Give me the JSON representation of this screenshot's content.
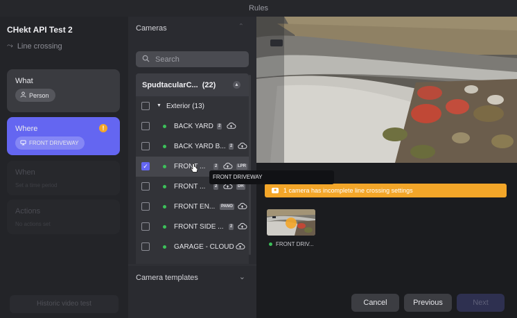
{
  "window": {
    "title": "Rules"
  },
  "left": {
    "project_title": "CHekt API Test 2",
    "rule_type": "Line crossing",
    "what": {
      "label": "What",
      "chip": "Person"
    },
    "where": {
      "label": "Where",
      "chip": "FRONT DRIVEWAY",
      "warning_glyph": "!"
    },
    "when": {
      "label": "When",
      "sub": "Set a time period"
    },
    "actions": {
      "label": "Actions",
      "sub": "No actions set"
    },
    "historic_button": "Historic video test"
  },
  "cameras": {
    "header": "Cameras",
    "search_placeholder": "Search",
    "group": {
      "name": "SpudtacularC...",
      "count": "(22)"
    },
    "subgroup": {
      "name": "Exterior (13)"
    },
    "items": [
      {
        "name": "BACK YARD",
        "badge": "2",
        "checked": false
      },
      {
        "name": "BACK YARD B...",
        "badge": "2",
        "checked": false
      },
      {
        "name": "FRONT ...",
        "badge": "2",
        "badge2": "LPR",
        "checked": true
      },
      {
        "name": "FRONT ...",
        "badge": "2",
        "badge2": "DR",
        "checked": false
      },
      {
        "name": "FRONT EN...",
        "badge": "PANO",
        "checked": false
      },
      {
        "name": "FRONT SIDE ...",
        "badge": "2",
        "checked": false
      },
      {
        "name": "GARAGE - CLOUD",
        "checked": false
      }
    ],
    "tooltip": "FRONT DRIVEWAY",
    "templates_label": "Camera templates"
  },
  "preview": {
    "warning": "1 camera has incomplete line crossing settings",
    "thumb_label": "FRONT DRIV..."
  },
  "footer": {
    "cancel": "Cancel",
    "previous": "Previous",
    "next": "Next"
  },
  "colors": {
    "accent": "#6466f1",
    "warning": "#f3a629",
    "online": "#3cc05a"
  }
}
